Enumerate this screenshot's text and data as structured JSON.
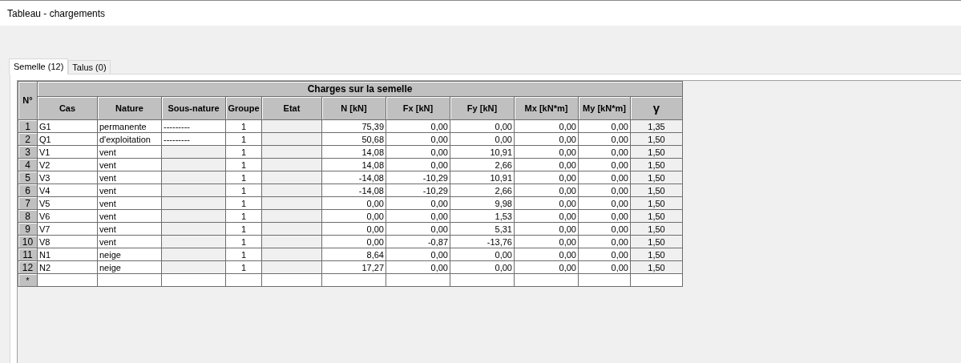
{
  "window": {
    "title": "Tableau - chargements"
  },
  "tabs": [
    {
      "label": "Semelle (12)",
      "selected": true
    },
    {
      "label": "Talus (0)",
      "selected": false
    }
  ],
  "table": {
    "corner": "N°",
    "group_header": "Charges sur la semelle",
    "columns": [
      "Cas",
      "Nature",
      "Sous-nature",
      "Groupe",
      "Etat",
      "N [kN]",
      "Fx [kN]",
      "Fy [kN]",
      "Mx [kN*m]",
      "My [kN*m]",
      "γ"
    ],
    "rows": [
      {
        "n": "1",
        "cas": "G1",
        "nature": "permanente",
        "sous_nature": "---------",
        "groupe": "1",
        "N": "75,39",
        "Fx": "0,00",
        "Fy": "0,00",
        "Mx": "0,00",
        "My": "0,00",
        "gamma": "1,35"
      },
      {
        "n": "2",
        "cas": "Q1",
        "nature": "d'exploitation",
        "sous_nature": "---------",
        "groupe": "1",
        "N": "50,68",
        "Fx": "0,00",
        "Fy": "0,00",
        "Mx": "0,00",
        "My": "0,00",
        "gamma": "1,50"
      },
      {
        "n": "3",
        "cas": "V1",
        "nature": "vent",
        "groupe": "1",
        "N": "14,08",
        "Fx": "0,00",
        "Fy": "10,91",
        "Mx": "0,00",
        "My": "0,00",
        "gamma": "1,50"
      },
      {
        "n": "4",
        "cas": "V2",
        "nature": "vent",
        "groupe": "1",
        "N": "14,08",
        "Fx": "0,00",
        "Fy": "2,66",
        "Mx": "0,00",
        "My": "0,00",
        "gamma": "1,50"
      },
      {
        "n": "5",
        "cas": "V3",
        "nature": "vent",
        "groupe": "1",
        "N": "-14,08",
        "Fx": "-10,29",
        "Fy": "10,91",
        "Mx": "0,00",
        "My": "0,00",
        "gamma": "1,50"
      },
      {
        "n": "6",
        "cas": "V4",
        "nature": "vent",
        "groupe": "1",
        "N": "-14,08",
        "Fx": "-10,29",
        "Fy": "2,66",
        "Mx": "0,00",
        "My": "0,00",
        "gamma": "1,50"
      },
      {
        "n": "7",
        "cas": "V5",
        "nature": "vent",
        "groupe": "1",
        "N": "0,00",
        "Fx": "0,00",
        "Fy": "9,98",
        "Mx": "0,00",
        "My": "0,00",
        "gamma": "1,50"
      },
      {
        "n": "8",
        "cas": "V6",
        "nature": "vent",
        "groupe": "1",
        "N": "0,00",
        "Fx": "0,00",
        "Fy": "1,53",
        "Mx": "0,00",
        "My": "0,00",
        "gamma": "1,50"
      },
      {
        "n": "9",
        "cas": "V7",
        "nature": "vent",
        "groupe": "1",
        "N": "0,00",
        "Fx": "0,00",
        "Fy": "5,31",
        "Mx": "0,00",
        "My": "0,00",
        "gamma": "1,50"
      },
      {
        "n": "10",
        "cas": "V8",
        "nature": "vent",
        "groupe": "1",
        "N": "0,00",
        "Fx": "-0,87",
        "Fy": "-13,76",
        "Mx": "0,00",
        "My": "0,00",
        "gamma": "1,50"
      },
      {
        "n": "11",
        "cas": "N1",
        "nature": "neige",
        "groupe": "1",
        "N": "8,64",
        "Fx": "0,00",
        "Fy": "0,00",
        "Mx": "0,00",
        "My": "0,00",
        "gamma": "1,50"
      },
      {
        "n": "12",
        "cas": "N2",
        "nature": "neige",
        "groupe": "1",
        "N": "17,27",
        "Fx": "0,00",
        "Fy": "0,00",
        "Mx": "0,00",
        "My": "0,00",
        "gamma": "1,50"
      }
    ],
    "new_row": "*"
  }
}
